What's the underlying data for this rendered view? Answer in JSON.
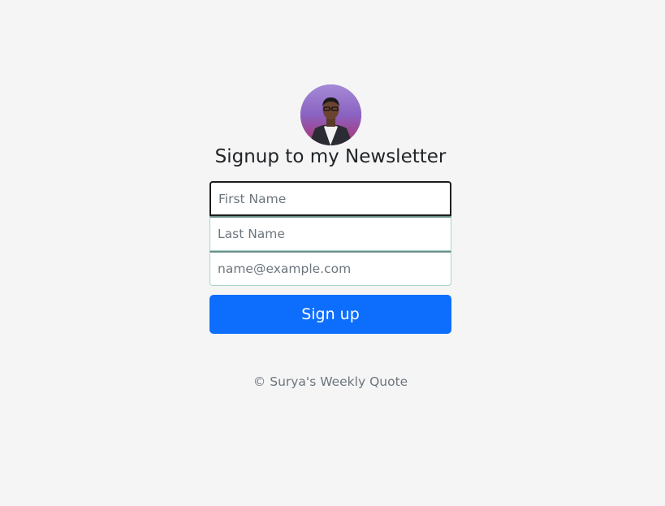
{
  "form": {
    "heading": "Signup to my Newsletter",
    "first_name_placeholder": "First Name",
    "last_name_placeholder": "Last Name",
    "email_placeholder": "name@example.com",
    "submit_label": "Sign up"
  },
  "footer": {
    "copyright": "© Surya's Weekly Quote"
  },
  "colors": {
    "background": "#f5f5f5",
    "button": "#0d6efd",
    "heading_text": "#212529",
    "muted_text": "#6c757d"
  }
}
